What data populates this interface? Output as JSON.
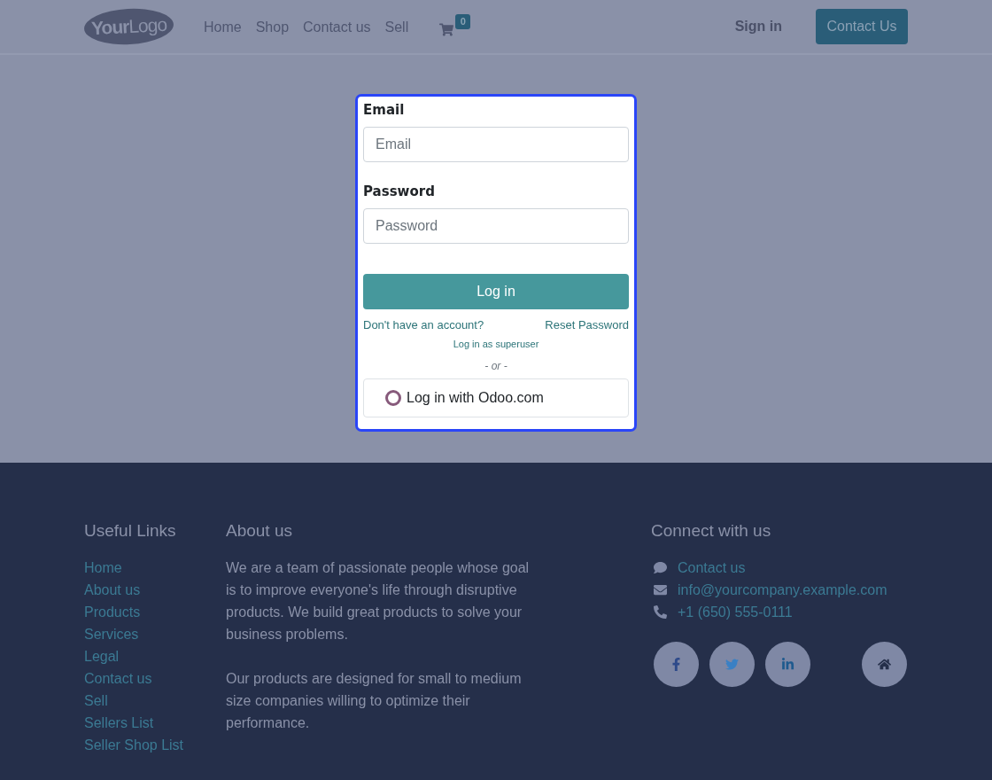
{
  "header": {
    "logo": {
      "bold": "Your",
      "light": "Logo"
    },
    "nav": [
      {
        "label": "Home"
      },
      {
        "label": "Shop"
      },
      {
        "label": "Contact us"
      },
      {
        "label": "Sell"
      }
    ],
    "cart": {
      "count": "0"
    },
    "sign_in": "Sign in",
    "cta": "Contact Us"
  },
  "login": {
    "fields": [
      {
        "label": "Email",
        "placeholder": "Email"
      },
      {
        "label": "Password",
        "placeholder": "Password"
      }
    ],
    "submit": "Log in",
    "signup_link": "Don't have an account?",
    "reset_link": "Reset Password",
    "superuser_link": "Log in as superuser",
    "separator": "- or -",
    "oauth_button": "Log in with Odoo.com"
  },
  "footer": {
    "useful_links": {
      "title": "Useful Links",
      "items": [
        "Home",
        "About us",
        "Products",
        "Services",
        "Legal",
        "Contact us",
        "Sell",
        "Sellers List",
        "Seller Shop List"
      ]
    },
    "about": {
      "title": "About us",
      "paragraphs": [
        "We are a team of passionate people whose goal is to improve everyone's life through disruptive products. We build great products to solve your business problems.",
        "Our products are designed for small to medium size companies willing to optimize their performance."
      ]
    },
    "connect": {
      "title": "Connect with us",
      "items": [
        {
          "kind": "chat",
          "text": "Contact us"
        },
        {
          "kind": "email",
          "text": "info@yourcompany.example.com"
        },
        {
          "kind": "phone",
          "text": "+1 (650) 555-0111"
        }
      ],
      "social": [
        {
          "kind": "facebook"
        },
        {
          "kind": "twitter"
        },
        {
          "kind": "linkedin"
        },
        {
          "kind": "home"
        }
      ]
    }
  }
}
